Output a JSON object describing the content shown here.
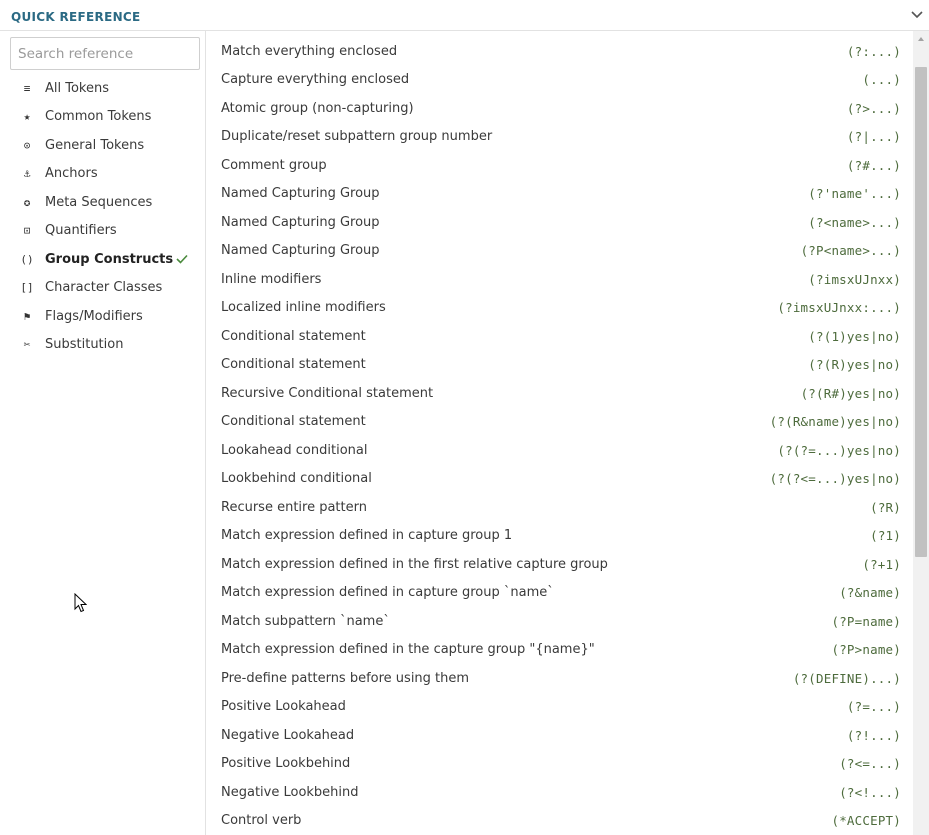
{
  "header": {
    "title": "QUICK REFERENCE",
    "collapse_icon": "chevron-down-icon"
  },
  "sidebar": {
    "search_placeholder": "Search reference",
    "search_value": "",
    "items": [
      {
        "label": "All Tokens",
        "icon": "stack-icon",
        "glyph": "≡"
      },
      {
        "label": "Common Tokens",
        "icon": "star-icon",
        "glyph": "★"
      },
      {
        "label": "General Tokens",
        "icon": "target-icon",
        "glyph": "⊙"
      },
      {
        "label": "Anchors",
        "icon": "anchor-icon",
        "glyph": "⚓"
      },
      {
        "label": "Meta Sequences",
        "icon": "asterisk-circle-icon",
        "glyph": "✪"
      },
      {
        "label": "Quantifiers",
        "icon": "quantifier-icon",
        "glyph": "⊡"
      },
      {
        "label": "Group Constructs",
        "icon": "parentheses-icon",
        "glyph": "()",
        "active": true
      },
      {
        "label": "Character Classes",
        "icon": "brackets-icon",
        "glyph": "[]"
      },
      {
        "label": "Flags/Modifiers",
        "icon": "flag-icon",
        "glyph": "⚑"
      },
      {
        "label": "Substitution",
        "icon": "scissors-icon",
        "glyph": "✂"
      }
    ],
    "active_indicator_icon": "checkmark-icon"
  },
  "main": {
    "rows": [
      {
        "desc": "Match everything enclosed",
        "token": "(?:...)"
      },
      {
        "desc": "Capture everything enclosed",
        "token": "(...)"
      },
      {
        "desc": "Atomic group (non-capturing)",
        "token": "(?>...)"
      },
      {
        "desc": "Duplicate/reset subpattern group number",
        "token": "(?|...)"
      },
      {
        "desc": "Comment group",
        "token": "(?#...)"
      },
      {
        "desc": "Named Capturing Group",
        "token": "(?'name'...)"
      },
      {
        "desc": "Named Capturing Group",
        "token": "(?<name>...)"
      },
      {
        "desc": "Named Capturing Group",
        "token": "(?P<name>...)"
      },
      {
        "desc": "Inline modifiers",
        "token": "(?imsxUJnxx)"
      },
      {
        "desc": "Localized inline modifiers",
        "token": "(?imsxUJnxx:...)"
      },
      {
        "desc": "Conditional statement",
        "token": "(?(1)yes|no)"
      },
      {
        "desc": "Conditional statement",
        "token": "(?(R)yes|no)"
      },
      {
        "desc": "Recursive Conditional statement",
        "token": "(?(R#)yes|no)"
      },
      {
        "desc": "Conditional statement",
        "token": "(?(R&name)yes|no)"
      },
      {
        "desc": "Lookahead conditional",
        "token": "(?(?=...)yes|no)"
      },
      {
        "desc": "Lookbehind conditional",
        "token": "(?(?<=...)yes|no)"
      },
      {
        "desc": "Recurse entire pattern",
        "token": "(?R)"
      },
      {
        "desc": "Match expression defined in capture group 1",
        "token": "(?1)"
      },
      {
        "desc": "Match expression defined in the first relative capture group",
        "token": "(?+1)"
      },
      {
        "desc": "Match expression defined in capture group `name`",
        "token": "(?&name)"
      },
      {
        "desc": "Match subpattern `name`",
        "token": "(?P=name)"
      },
      {
        "desc": "Match expression defined in the capture group \"{name}\"",
        "token": "(?P>name)"
      },
      {
        "desc": "Pre-define patterns before using them",
        "token": "(?(DEFINE)...)"
      },
      {
        "desc": "Positive Lookahead",
        "token": "(?=...)"
      },
      {
        "desc": "Negative Lookahead",
        "token": "(?!...)"
      },
      {
        "desc": "Positive Lookbehind",
        "token": "(?<=...)"
      },
      {
        "desc": "Negative Lookbehind",
        "token": "(?<!...)"
      },
      {
        "desc": "Control verb",
        "token": "(*ACCEPT)"
      }
    ]
  }
}
